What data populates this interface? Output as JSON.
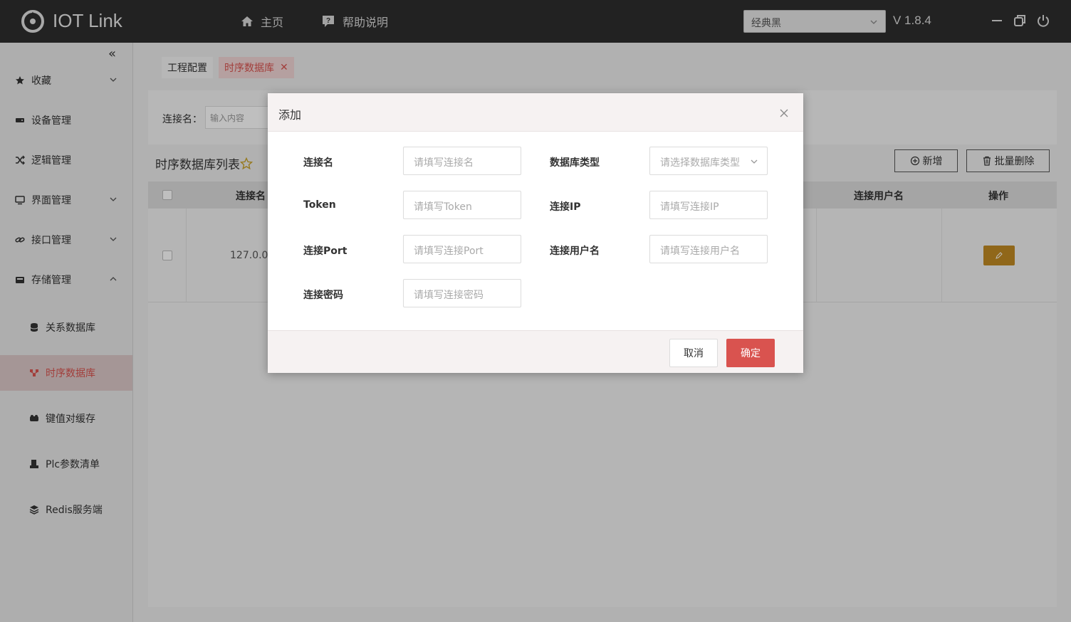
{
  "app": {
    "title": "IOT Link",
    "version": "V 1.8.4",
    "theme_value": "经典黑"
  },
  "nav": {
    "home": "主页",
    "help": "帮助说明"
  },
  "icons": {
    "logo": "iot-logo-icon",
    "home": "home-icon",
    "help": "help-icon",
    "minimize": "minimize-icon",
    "restore": "restore-icon",
    "power": "power-icon"
  },
  "sidebar": {
    "collapse": "«",
    "items": [
      {
        "label": "收藏",
        "icon": "star-icon",
        "expandable": true
      },
      {
        "label": "设备管理",
        "icon": "device-icon"
      },
      {
        "label": "逻辑管理",
        "icon": "shuffle-icon"
      },
      {
        "label": "界面管理",
        "icon": "monitor-icon",
        "expandable": true
      },
      {
        "label": "接口管理",
        "icon": "link-icon",
        "expandable": true
      },
      {
        "label": "存储管理",
        "icon": "storage-icon",
        "expanded": true
      }
    ],
    "sub_items": [
      {
        "label": "关系数据库",
        "icon": "database-icon"
      },
      {
        "label": "时序数据库",
        "icon": "timeseries-icon",
        "active": true
      },
      {
        "label": "键值对缓存",
        "icon": "cache-icon"
      },
      {
        "label": "Plc参数清单",
        "icon": "plc-icon"
      },
      {
        "label": "Redis服务端",
        "icon": "layers-icon"
      }
    ]
  },
  "tabs": [
    {
      "label": "工程配置"
    },
    {
      "label": "时序数据库",
      "active": true
    }
  ],
  "search": {
    "label": "连接名：",
    "placeholder": "输入内容"
  },
  "list": {
    "title": "时序数据库列表",
    "add_button": "新增",
    "batch_delete_button": "批量删除",
    "columns": [
      "连接名",
      "连接用户名",
      "操作"
    ],
    "rows": [
      {
        "connection_name": "127.0.0.1"
      }
    ]
  },
  "modal": {
    "title": "添加",
    "fields": {
      "name": {
        "label": "连接名",
        "placeholder": "请填写连接名"
      },
      "db_type": {
        "label": "数据库类型",
        "placeholder": "请选择数据库类型"
      },
      "token": {
        "label": "Token",
        "placeholder": "请填写Token"
      },
      "ip": {
        "label": "连接IP",
        "placeholder": "请填写连接IP"
      },
      "port": {
        "label": "连接Port",
        "placeholder": "请填写连接Port"
      },
      "username": {
        "label": "连接用户名",
        "placeholder": "请填写连接用户名"
      },
      "password": {
        "label": "连接密码",
        "placeholder": "请填写连接密码"
      }
    },
    "cancel": "取消",
    "confirm": "确定"
  },
  "colors": {
    "accent": "#d9534f",
    "header_bg": "#2e2e2e",
    "edit_button": "#c18a23"
  }
}
